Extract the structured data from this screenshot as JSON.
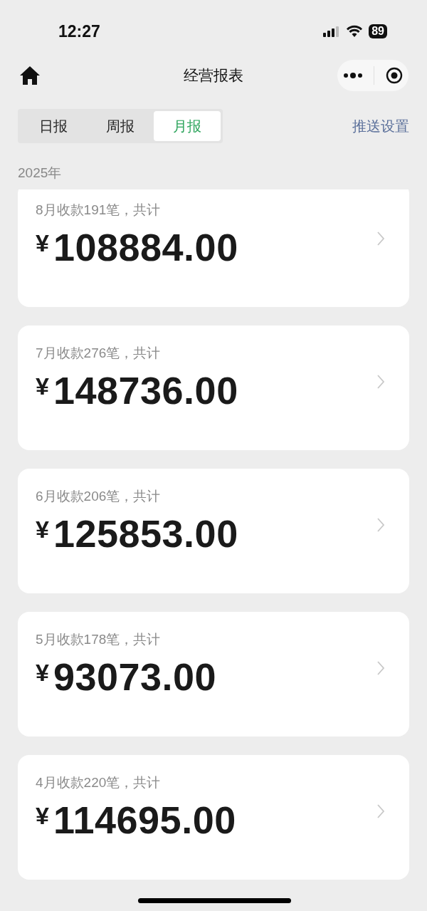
{
  "status_bar": {
    "time": "12:27",
    "battery": "89"
  },
  "nav": {
    "title": "经营报表"
  },
  "tabs": [
    {
      "label": "日报",
      "selected": false
    },
    {
      "label": "周报",
      "selected": false
    },
    {
      "label": "月报",
      "selected": true
    }
  ],
  "push_settings": "推送设置",
  "year": "2025年",
  "months": [
    {
      "summary": "8月收款191笔，共计",
      "currency": "¥",
      "amount": "108884.00"
    },
    {
      "summary": "7月收款276笔，共计",
      "currency": "¥",
      "amount": "148736.00"
    },
    {
      "summary": "6月收款206笔，共计",
      "currency": "¥",
      "amount": "125853.00"
    },
    {
      "summary": "5月收款178笔，共计",
      "currency": "¥",
      "amount": "93073.00"
    },
    {
      "summary": "4月收款220笔，共计",
      "currency": "¥",
      "amount": "114695.00"
    }
  ]
}
